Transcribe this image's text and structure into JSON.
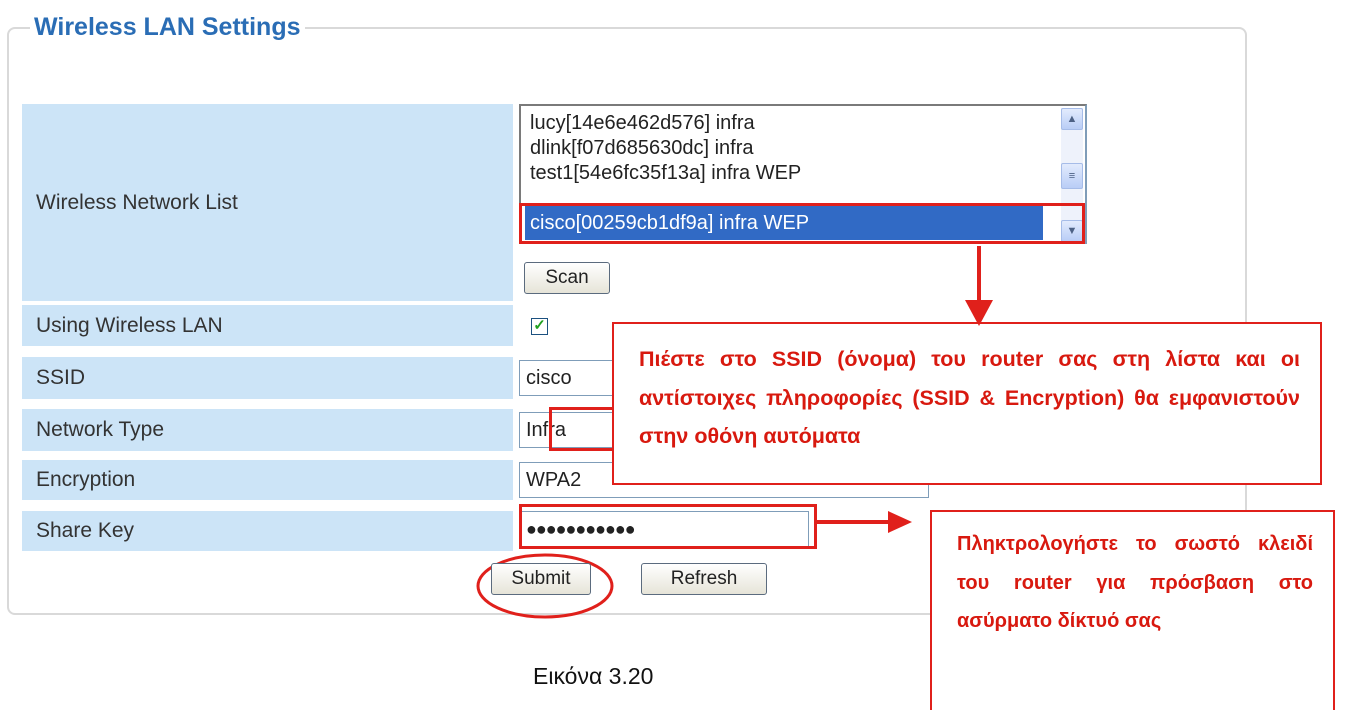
{
  "panel": {
    "title": "Wireless LAN Settings"
  },
  "rows": {
    "network_list": "Wireless Network List",
    "using_wlan": "Using Wireless LAN",
    "ssid": "SSID",
    "network_type": "Network Type",
    "encryption": "Encryption",
    "share_key": "Share Key"
  },
  "networks": [
    "lucy[14e6e462d576] infra",
    "dlink[f07d685630dc] infra",
    "test1[54e6fc35f13a] infra WEP",
    "cisco[00259cb1df9a] infra WEP"
  ],
  "selected_network_index": 3,
  "buttons": {
    "scan": "Scan",
    "submit": "Submit",
    "refresh": "Refresh"
  },
  "fields": {
    "using_wlan_checked": true,
    "ssid": "cisco",
    "network_type": "Infra",
    "encryption": "WPA2",
    "share_key": "●●●●●●●●●●●"
  },
  "annotations": {
    "callout1": "Πιέστε στο SSID (όνομα) του router σας στη λίστα και οι αντίστοιχες πληροφορίες (SSID & Encryption) θα εμφανιστούν στην οθόνη αυτόματα",
    "callout2": "Πληκτρολογήστε το σωστό κλειδί του router για πρόσβαση στο ασύρματο δίκτυό σας",
    "caption": "Εικόνα 3.20",
    "accent_color": "#e0201b",
    "title_color": "#2a6db5",
    "label_bg": "#cce4f7",
    "selection_color": "#316ac5"
  }
}
